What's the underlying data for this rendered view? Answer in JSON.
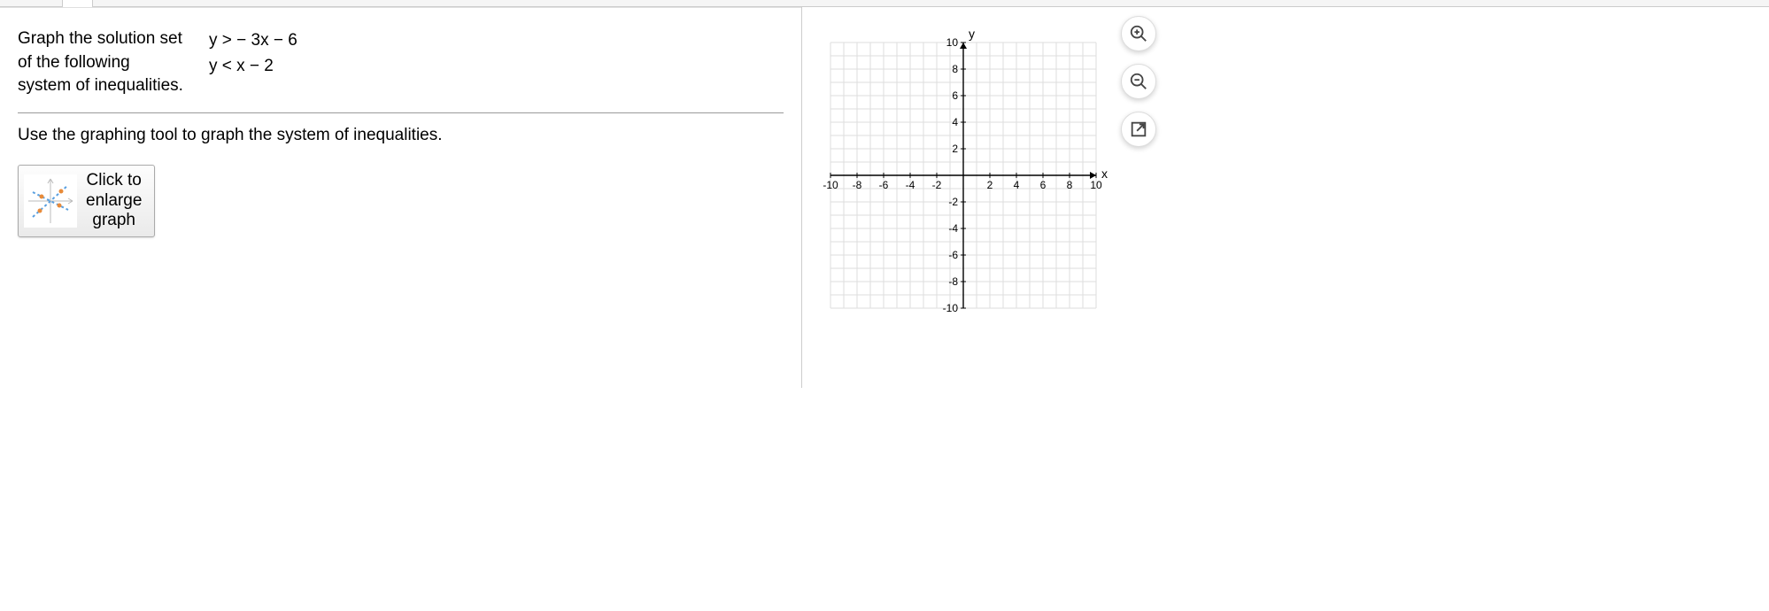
{
  "question": {
    "col1_line1": "Graph the solution set",
    "col1_line2": "of the following",
    "col1_line3": "system of inequalities.",
    "ineq1": "y  >   − 3x − 6",
    "ineq2": "y  <   x − 2"
  },
  "instruction": "Use the graphing tool to graph the system of inequalities.",
  "enlarge": {
    "line1": "Click to",
    "line2": "enlarge",
    "line3": "graph"
  },
  "chart_data": {
    "type": "scatter",
    "title": "",
    "xlabel": "x",
    "ylabel": "y",
    "xlim": [
      -10,
      10
    ],
    "ylim": [
      -10,
      10
    ],
    "xticks": [
      -10,
      -8,
      -6,
      -4,
      -2,
      2,
      4,
      6,
      8,
      10
    ],
    "yticks": [
      -10,
      -8,
      -6,
      -4,
      -2,
      2,
      4,
      6,
      8,
      10
    ],
    "grid": true,
    "series": []
  },
  "tools": {
    "zoom_in": "zoom-in",
    "zoom_out": "zoom-out",
    "popout": "popout"
  }
}
